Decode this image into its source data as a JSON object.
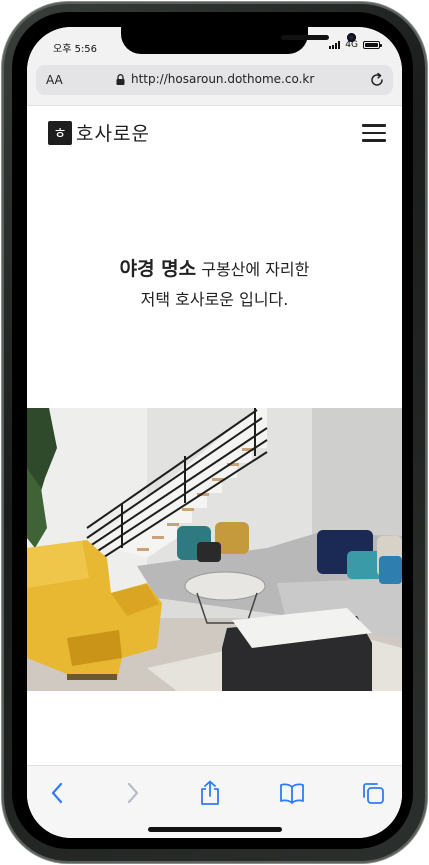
{
  "status": {
    "time": "오후 5:56",
    "network": "4G"
  },
  "browser": {
    "aa_label": "AA",
    "url": "http://hosaroun.dothome.co.kr"
  },
  "site": {
    "logo_mark": "ㅎ",
    "logo_text": "호사로운"
  },
  "hero": {
    "line1_bold": "야경 명소",
    "line1_rest": " 구봉산에 자리한",
    "line2": "저택 호사로운 입니다."
  },
  "colors": {
    "accent": "#2f7cf6",
    "disabled": "#b8bcc4",
    "sofa_yellow": "#e8b832",
    "sofa_teal": "#3a9aa8"
  },
  "icons": {
    "status": [
      "signal-icon",
      "battery-icon"
    ],
    "urlbar": [
      "lock-icon",
      "reload-icon"
    ],
    "toolbar": [
      "back-icon",
      "forward-icon",
      "share-icon",
      "bookmarks-icon",
      "tabs-icon"
    ]
  }
}
